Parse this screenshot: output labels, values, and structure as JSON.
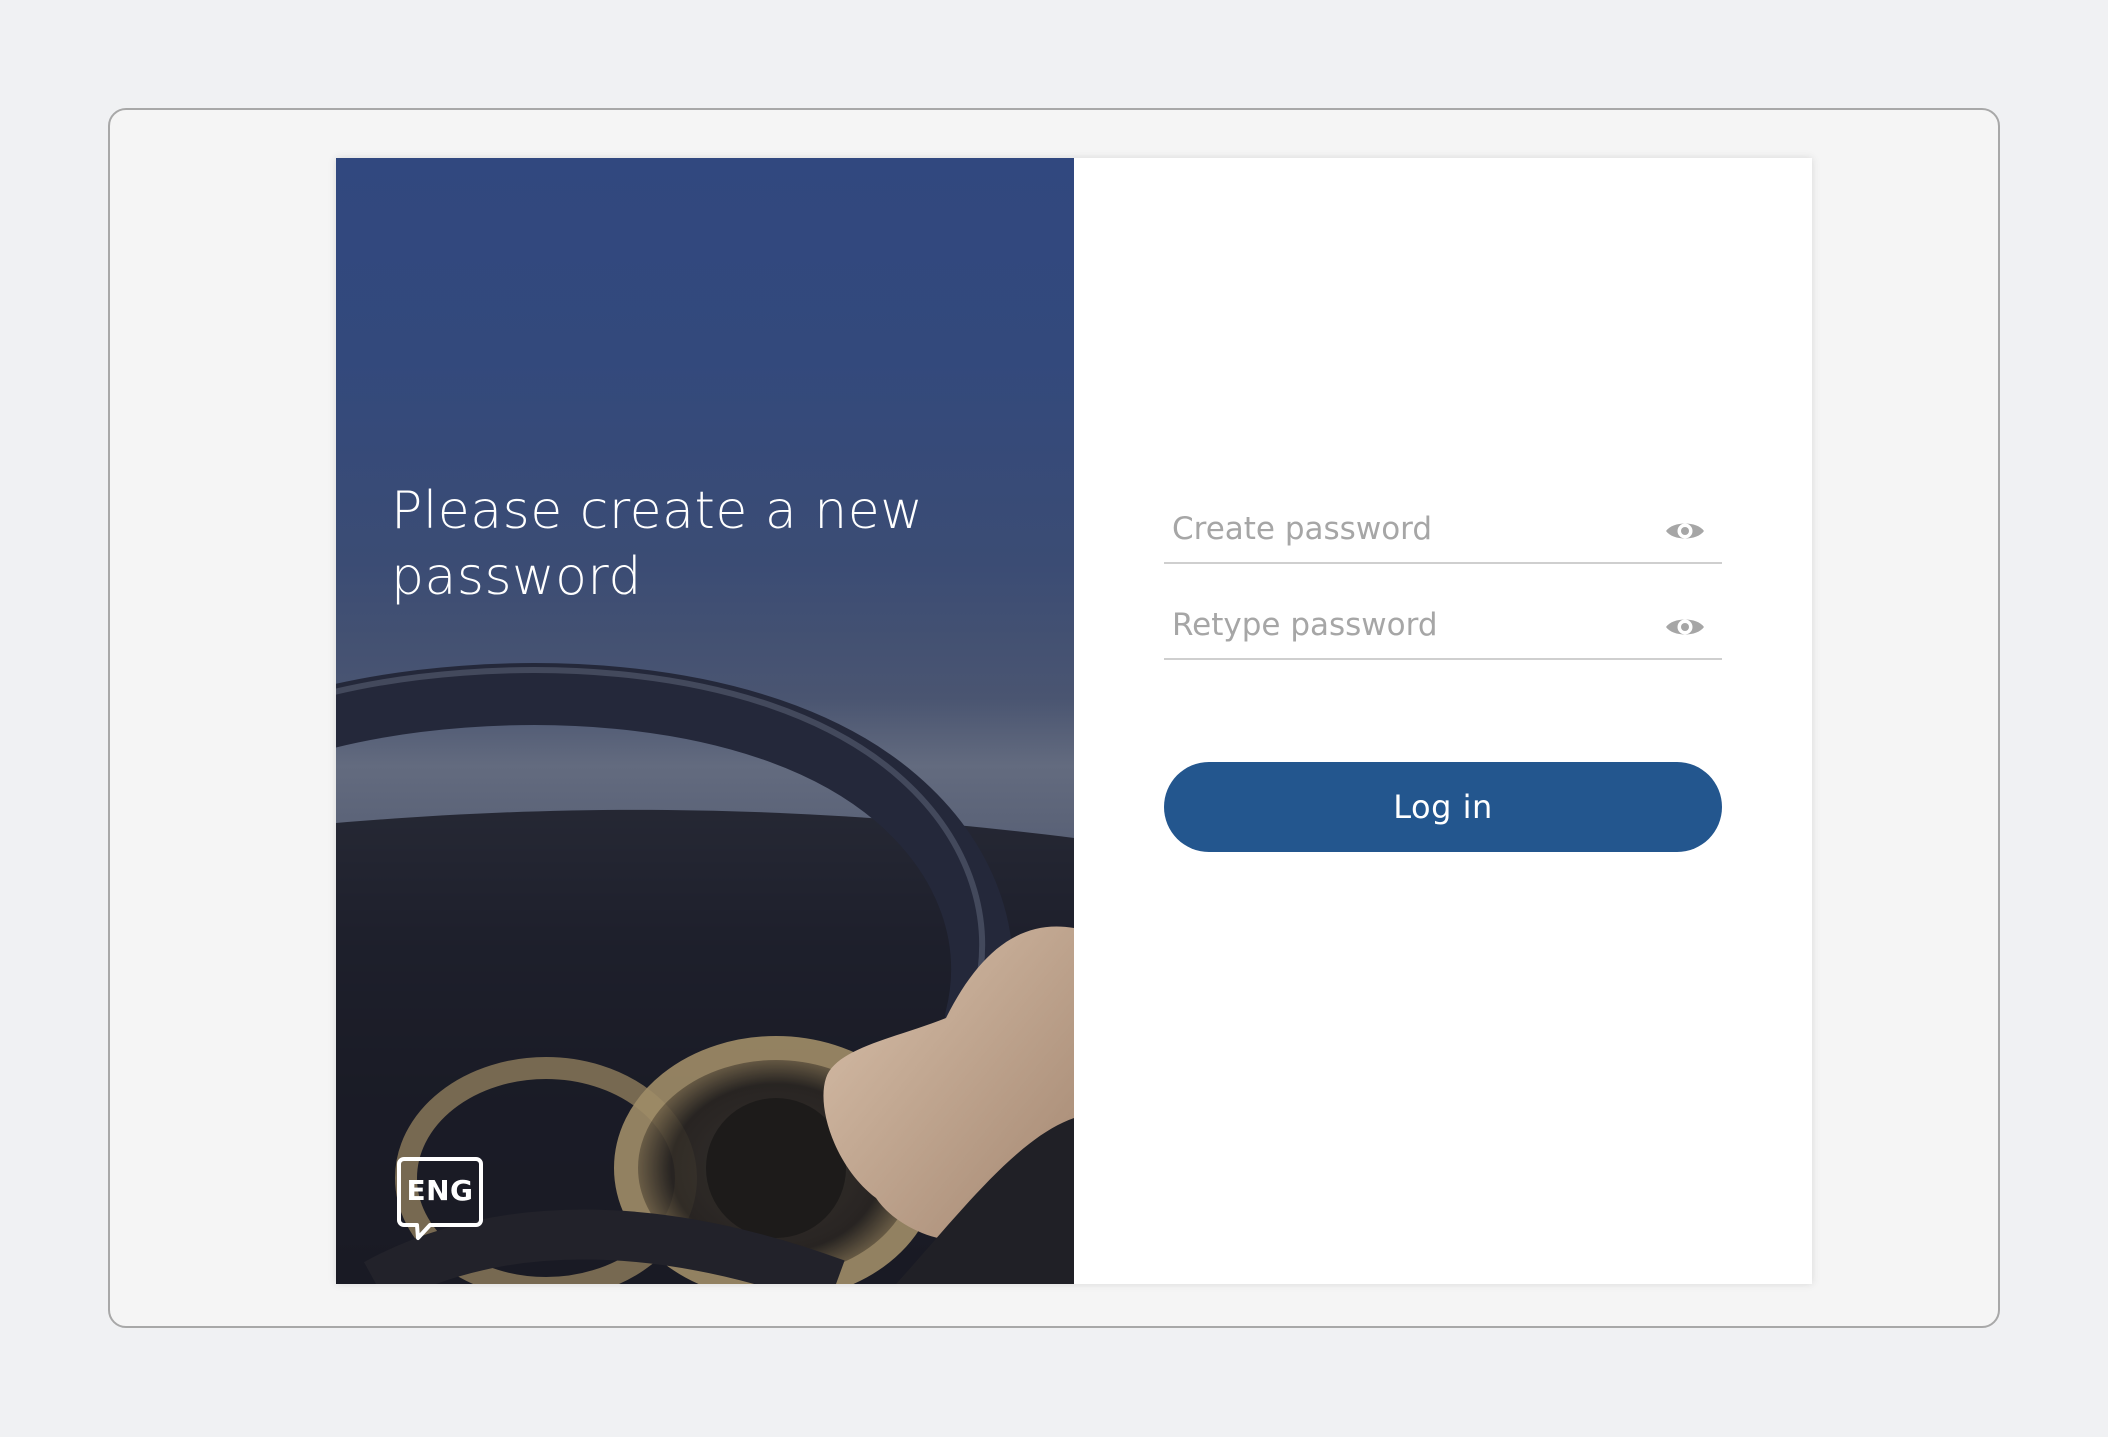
{
  "hero": {
    "title": "Please create a new password",
    "language_label": "ENG",
    "language_icon": "speech-bubble-icon",
    "background_image": "hands-on-steering-wheel-photo"
  },
  "form": {
    "create_password": {
      "placeholder": "Create password",
      "value": "",
      "icon": "eye-icon"
    },
    "retype_password": {
      "placeholder": "Retype password",
      "value": "",
      "icon": "eye-icon"
    },
    "login_label": "Log in"
  },
  "colors": {
    "hero_blue": "#31487f",
    "button_blue": "#23568e",
    "placeholder_gray": "#a6a6a6",
    "underline_gray": "#cfcfcf"
  }
}
